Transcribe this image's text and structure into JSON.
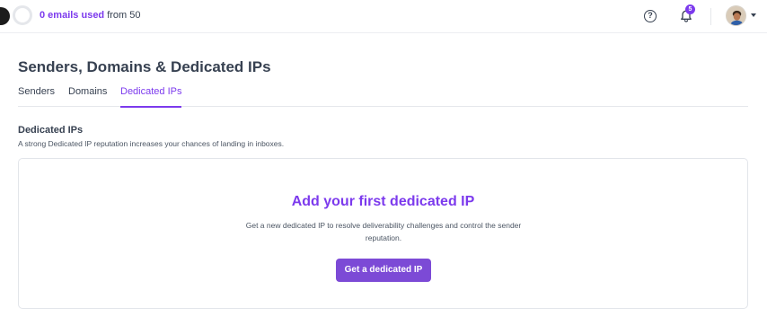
{
  "topbar": {
    "usage": {
      "count": "0 emails used",
      "suffix": " from 50"
    },
    "help_icon": "question-circle",
    "notifications": {
      "icon": "bell",
      "badge": "5"
    },
    "avatar": "user-avatar"
  },
  "page": {
    "title": "Senders, Domains & Dedicated IPs"
  },
  "tabs": [
    {
      "label": "Senders",
      "active": false
    },
    {
      "label": "Domains",
      "active": false
    },
    {
      "label": "Dedicated IPs",
      "active": true
    }
  ],
  "section": {
    "title": "Dedicated IPs",
    "description": "A strong Dedicated IP reputation increases your chances of landing in inboxes."
  },
  "empty_state": {
    "title": "Add your first dedicated IP",
    "description": "Get a new dedicated IP to resolve deliverability challenges and control the sender reputation.",
    "cta_label": "Get a dedicated IP"
  },
  "colors": {
    "accent": "#7c3aed",
    "button": "#7c4ad6"
  }
}
